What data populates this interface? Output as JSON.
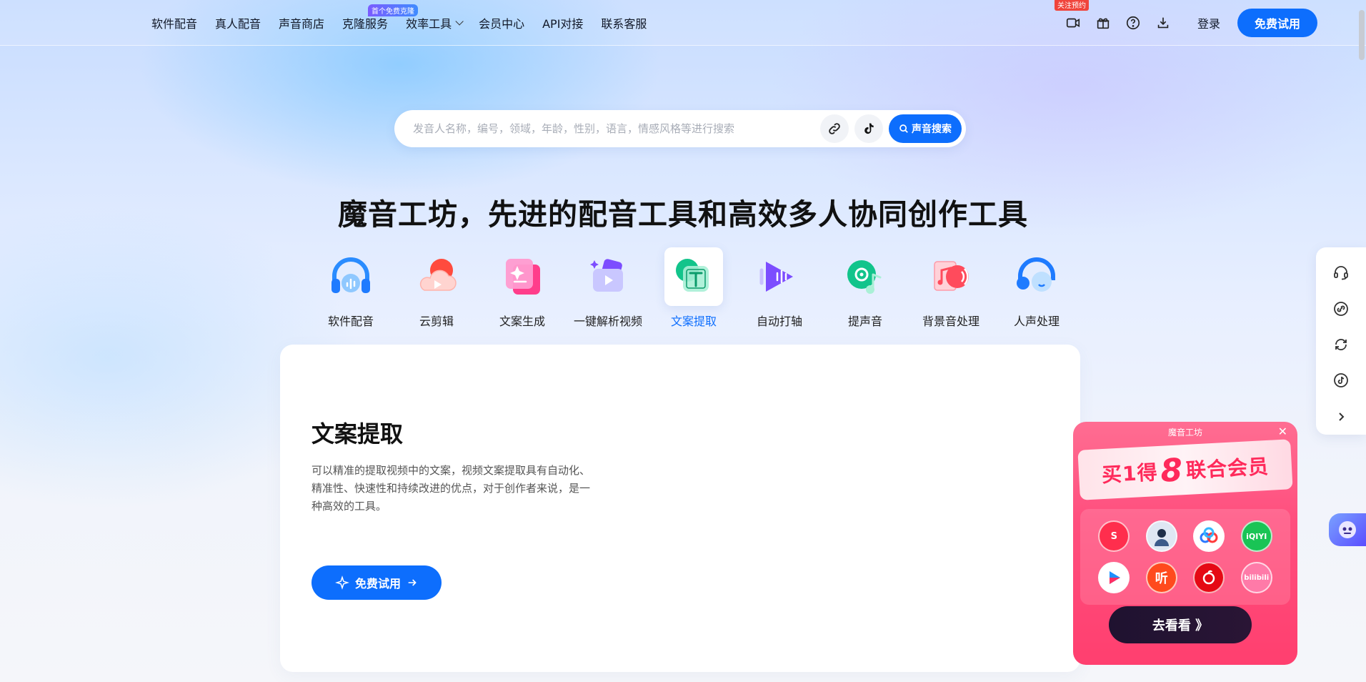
{
  "nav": {
    "items": [
      {
        "label": "软件配音"
      },
      {
        "label": "真人配音"
      },
      {
        "label": "声音商店"
      },
      {
        "label": "克隆服务",
        "badge": "首个免费克隆"
      },
      {
        "label": "效率工具"
      },
      {
        "label": "会员中心"
      },
      {
        "label": "API对接"
      },
      {
        "label": "联系客服"
      }
    ],
    "video_badge": "关注预约",
    "login": "登录",
    "trial": "免费试用"
  },
  "search": {
    "placeholder": "发音人名称，编号，领域，年龄，性别，语言，情感风格等进行搜索",
    "button": "声音搜索"
  },
  "hero": {
    "title": "魔音工坊，先进的配音工具和高效多人协同创作工具"
  },
  "tools": [
    {
      "label": "软件配音",
      "icon": "headphones-icon"
    },
    {
      "label": "云剪辑",
      "icon": "cloud-play-icon"
    },
    {
      "label": "文案生成",
      "icon": "sparkle-doc-icon"
    },
    {
      "label": "一键解析视频",
      "icon": "video-parse-icon"
    },
    {
      "label": "文案提取",
      "icon": "text-extract-icon",
      "active": true
    },
    {
      "label": "自动打轴",
      "icon": "timeline-icon"
    },
    {
      "label": "提声音",
      "icon": "vinyl-note-icon"
    },
    {
      "label": "背景音处理",
      "icon": "bg-music-icon"
    },
    {
      "label": "人声处理",
      "icon": "voice-headset-icon"
    }
  ],
  "card": {
    "title": "文案提取",
    "description": "可以精准的提取视频中的文案，视频文案提取具有自动化、精准性、快速性和持续改进的优点，对于创作者来说，是一种高效的工具。",
    "button": "免费试用"
  },
  "promo": {
    "brand": "魔音工坊",
    "headline_pre": "买1得",
    "headline_num": "8",
    "headline_post": "联合会员",
    "logos": [
      "S",
      "",
      "",
      "iQIYI",
      "",
      "听",
      "",
      "bilibili"
    ],
    "button": "去看看 》"
  },
  "colors": {
    "primary": "#0d6efd",
    "promo": "#ff4f7e"
  }
}
